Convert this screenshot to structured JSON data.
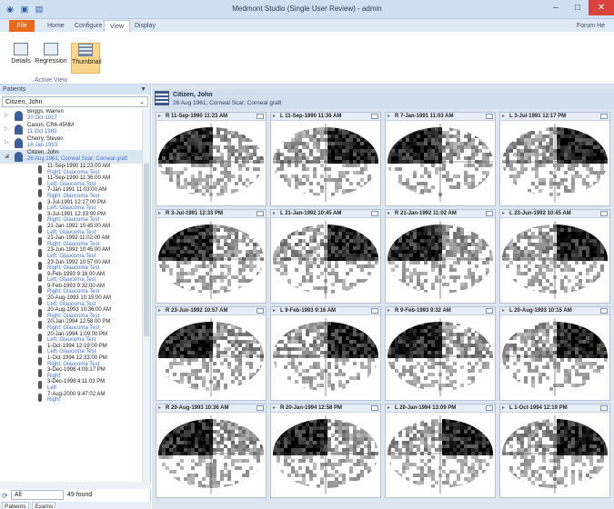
{
  "window": {
    "title": "Medmont Studio (Single User Review) - admin"
  },
  "ribbon": {
    "tabs": [
      "File",
      "Home",
      "Configure",
      "View",
      "Display"
    ],
    "active_tab": "View",
    "right_link": "Forum  He",
    "buttons": [
      {
        "label": "Details"
      },
      {
        "label": "Regression"
      },
      {
        "label": "Thumbnail"
      }
    ],
    "group_label": "Active View"
  },
  "left_panel": {
    "title": "Patients",
    "selected_patient": "Citizen, John",
    "patients": [
      {
        "name": "Briggs, Warren",
        "dob": "20 Oct 1917"
      },
      {
        "name": "Canon, CR6-45NM",
        "dob": "11 Oct 1980"
      },
      {
        "name": "Cherry, Steven",
        "dob": "16 Jan 1953"
      },
      {
        "name": "Citizen, John",
        "dob": "26 Aug 1961; Corneal Scar; Corneal graft"
      }
    ],
    "exams": [
      {
        "dt": "11-Sep-1990 11:23:00 AM",
        "desc": "Right; Glaucoma Test"
      },
      {
        "dt": "11-Sep-1990 11:36:00 AM",
        "desc": "Left; Glaucoma Test"
      },
      {
        "dt": "7-Jan-1991 11:03:00 AM",
        "desc": "Right; Glaucoma Test"
      },
      {
        "dt": "3-Jul-1991 12:17:00 PM",
        "desc": "Left; Glaucoma Test"
      },
      {
        "dt": "3-Jul-1991 12:33:00 PM",
        "desc": "Right; Glaucoma Test"
      },
      {
        "dt": "21-Jan-1992 10:45:00 AM",
        "desc": "Left; Glaucoma Test"
      },
      {
        "dt": "21-Jan-1992 11:02:00 AM",
        "desc": "Right; Glaucoma Test"
      },
      {
        "dt": "23-Jun-1992 10:45:00 AM",
        "desc": "Left; Glaucoma Test"
      },
      {
        "dt": "23-Jun-1992 10:57:00 AM",
        "desc": "Right; Glaucoma Test"
      },
      {
        "dt": "9-Feb-1993 9:16:00 AM",
        "desc": "Left; Glaucoma Test"
      },
      {
        "dt": "9-Feb-1993 9:32:00 AM",
        "desc": "Right; Glaucoma Test"
      },
      {
        "dt": "20-Aug-1993 10:15:00 AM",
        "desc": "Left; Glaucoma Test"
      },
      {
        "dt": "20-Aug-1993 10:36:00 AM",
        "desc": "Right; Glaucoma Test"
      },
      {
        "dt": "20-Jan-1994 12:58:00 PM",
        "desc": "Right; Glaucoma Test"
      },
      {
        "dt": "20-Jan-1994 1:09:00 PM",
        "desc": "Left; Glaucoma Test"
      },
      {
        "dt": "1-Oct-1994 12:19:00 PM",
        "desc": "Left; Glaucoma Test"
      },
      {
        "dt": "1-Oct-1994 12:33:00 PM",
        "desc": "Right; Glaucoma Test"
      },
      {
        "dt": "3-Dec-1998 4:09:17 PM",
        "desc": "Right"
      },
      {
        "dt": "3-Dec-1998 4:11:03 PM",
        "desc": "Left"
      },
      {
        "dt": "7-Aug-2000 9:47:02 AM",
        "desc": "Right"
      }
    ],
    "filter_value": "All",
    "found_count": "49 found",
    "bottom_tabs": [
      "Patients",
      "Exams"
    ]
  },
  "main": {
    "patient_name": "Citizen, John",
    "patient_sub": "26 Aug 1961; Corneal Scar; Corneal graft",
    "thumbnails": [
      "R 11-Sep-1990 11:23 AM",
      "L 11-Sep-1990 11:36 AM",
      "R 7-Jan-1991 11:03 AM",
      "L 3-Jul-1991 12:17 PM",
      "R 3-Jul-1991 12:33 PM",
      "L 21-Jan-1992 10:45 AM",
      "R 21-Jan-1992 11:02 AM",
      "L 23-Jun-1992 10:45 AM",
      "R 23-Jun-1992 10:57 AM",
      "L 9-Feb-1993 9:16 AM",
      "R 9-Feb-1993 9:32 AM",
      "L 20-Aug-1993 10:15 AM",
      "R 20-Aug-1993 10:36 AM",
      "R 20-Jan-1994 12:58 PM",
      "L 20-Jan-1994 13:09 PM",
      "L 1-Oct-1994 12:19 PM"
    ]
  }
}
